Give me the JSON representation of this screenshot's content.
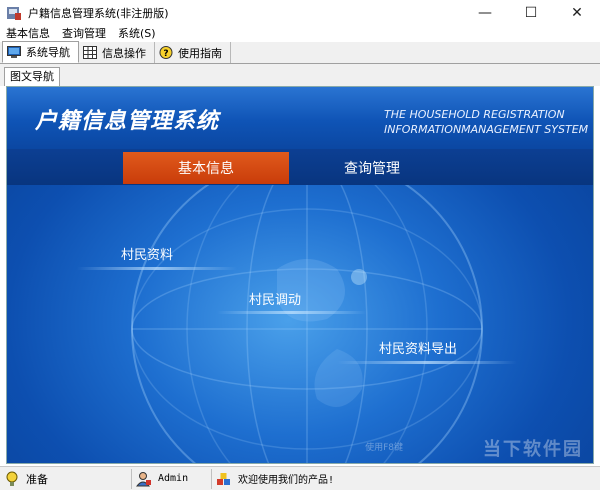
{
  "window": {
    "title": "户籍信息管理系统(非注册版)",
    "controls": {
      "minimize": "—",
      "maximize": "☐",
      "close": "✕"
    }
  },
  "menubar": {
    "items": [
      {
        "label": "基本信息"
      },
      {
        "label": "查询管理"
      },
      {
        "label": "系统(S)"
      }
    ]
  },
  "toolbar": {
    "tabs": [
      {
        "label": "系统导航",
        "icon": "monitor-icon",
        "active": true
      },
      {
        "label": "信息操作",
        "icon": "grid-icon",
        "active": false
      },
      {
        "label": "使用指南",
        "icon": "help-icon",
        "active": false
      }
    ]
  },
  "subtab": {
    "label": "图文导航"
  },
  "banner": {
    "title": "户籍信息管理系统",
    "subtitle_en_line1": "THE HOUSEHOLD REGISTRATION",
    "subtitle_en_line2": "INFORMATIONMANAGEMENT SYSTEM"
  },
  "nav": {
    "items": [
      {
        "label": "基本信息",
        "active": true
      },
      {
        "label": "查询管理",
        "active": false
      }
    ]
  },
  "links": {
    "villager_info": "村民资料",
    "villager_transfer": "村民调动",
    "villager_export": "村民资料导出"
  },
  "watermark": {
    "hint": "使用F8键",
    "logo": "当下软件园"
  },
  "statusbar": {
    "ready": "准备",
    "user": "Admin",
    "message": "欢迎使用我们的产品!"
  },
  "colors": {
    "accent_orange": "#d84812",
    "banner_blue": "#0f54b6",
    "nav_blue": "#0a3a88"
  }
}
